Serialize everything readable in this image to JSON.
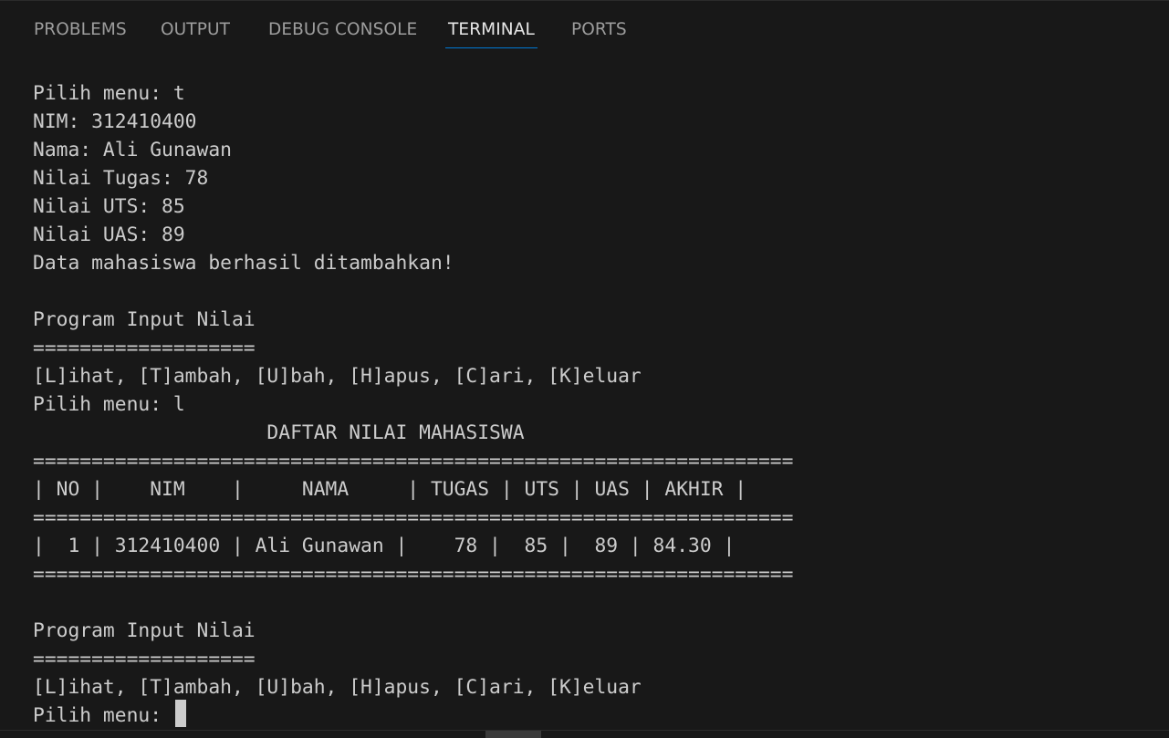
{
  "tabs": [
    {
      "label": "PROBLEMS",
      "active": false
    },
    {
      "label": "OUTPUT",
      "active": false
    },
    {
      "label": "DEBUG CONSOLE",
      "active": false
    },
    {
      "label": "TERMINAL",
      "active": true
    },
    {
      "label": "PORTS",
      "active": false
    }
  ],
  "terminal": {
    "lines": [
      "Pilih menu: t",
      "NIM: 312410400",
      "Nama: Ali Gunawan",
      "Nilai Tugas: 78",
      "Nilai UTS: 85",
      "Nilai UAS: 89",
      "Data mahasiswa berhasil ditambahkan!",
      "",
      "Program Input Nilai",
      "===================",
      "[L]ihat, [T]ambah, [U]bah, [H]apus, [C]ari, [K]eluar",
      "Pilih menu: l",
      "                    DAFTAR NILAI MAHASISWA",
      "=================================================================",
      "| NO |    NIM    |     NAMA     | TUGAS | UTS | UAS | AKHIR |",
      "=================================================================",
      "|  1 | 312410400 | Ali Gunawan |    78 |  85 |  89 | 84.30 |",
      "=================================================================",
      "",
      "Program Input Nilai",
      "===================",
      "[L]ihat, [T]ambah, [U]bah, [H]apus, [C]ari, [K]eluar",
      "Pilih menu: "
    ]
  },
  "colors": {
    "background": "#181818",
    "text": "#cccccc",
    "active_tab_underline": "#0078d4"
  }
}
